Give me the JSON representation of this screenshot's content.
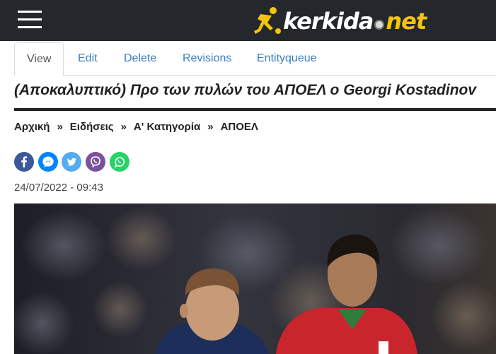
{
  "header": {
    "logo_text_part1": "kerkida",
    "logo_text_part2": "net",
    "brand_colors": {
      "bar": "#24272c",
      "accent": "#f5c30f"
    }
  },
  "tabs": [
    {
      "label": "View",
      "active": true
    },
    {
      "label": "Edit",
      "active": false
    },
    {
      "label": "Delete",
      "active": false
    },
    {
      "label": "Revisions",
      "active": false
    },
    {
      "label": "Entityqueue",
      "active": false
    }
  ],
  "article": {
    "title": "(Αποκαλυπτικό) Προ των πυλών του ΑΠΟΕΛ ο Georgi Kostadinov",
    "date": "24/07/2022 - 09:43"
  },
  "breadcrumb": {
    "items": [
      "Αρχική",
      "Ειδήσεις",
      "Α' Κατηγορία",
      "ΑΠΟΕΛ"
    ],
    "separator": "»"
  },
  "share": {
    "buttons": [
      {
        "icon": "facebook-icon",
        "color": "#3b5998"
      },
      {
        "icon": "messenger-icon",
        "color": "#0084ff"
      },
      {
        "icon": "twitter-icon",
        "color": "#55acee"
      },
      {
        "icon": "viber-icon",
        "color": "#7b519d"
      },
      {
        "icon": "whatsapp-icon",
        "color": "#25d366"
      }
    ]
  }
}
